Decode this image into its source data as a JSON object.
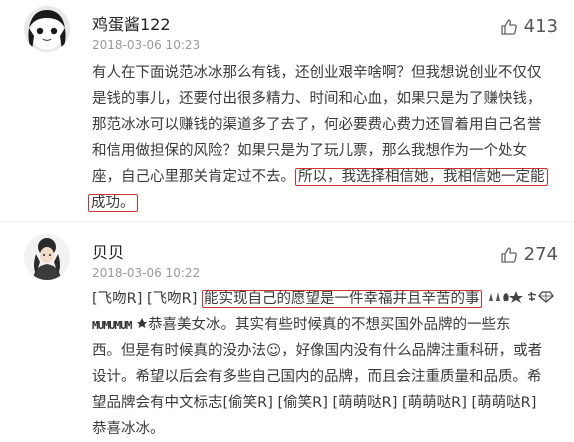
{
  "comments": [
    {
      "username": "鸡蛋酱122",
      "timestamp": "2018-03-06 10:23",
      "likes": "413",
      "lines": [
        "有人在下面说范冰冰那么有钱，还创业艰辛啥啊？但我想说创业不仅仅",
        "是钱的事儿，还要付出很多精力、时间和心血，如果只是为了赚快钱，",
        "那范冰冰可以赚钱的渠道多了去了，何必要费心费力还冒着用自己名誉",
        "和信用做担保的风险？如果只是为了玩儿票，那么我想作为一个处女"
      ],
      "line5_prefix": "座，自己心里那关肯定过不去。",
      "highlight_1": "所以，我选择相信她，我相信她一定能",
      "highlight_2": "成功。"
    },
    {
      "username": "贝贝",
      "timestamp": "2018-03-06 10:22",
      "likes": "274",
      "line1_prefix": "[飞吻R] [飞吻R] ",
      "highlight": "能实现自己的愿望是一件幸福并且辛苦的事",
      "line2_deco": "MUMUMUM",
      "line2_rest": "恭喜美女冰。其实有些时候真的不想买国外品牌的一些东",
      "lines": [
        "西。但是有时候真的没办法☺，好像国内没有什么品牌注重科研，或者",
        "设计。希望以后会有多些自己国内的品牌，而且会注重质量和品质。希",
        "望品牌会有中文标志[偷笑R] [偷笑R]  [萌萌哒R] [萌萌哒R] [萌萌哒R]",
        "恭喜冰冰。"
      ]
    }
  ],
  "icons": {
    "like": "thumbs-up-icon"
  },
  "colors": {
    "highlight_border": "#d0322f",
    "timestamp": "#9a9a9a"
  }
}
